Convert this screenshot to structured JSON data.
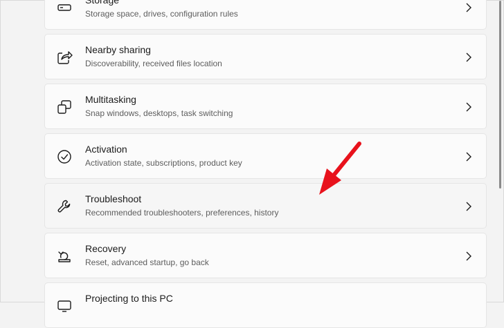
{
  "items": [
    {
      "title": "Storage",
      "subtitle": "Storage space, drives, configuration rules",
      "icon": "storage-icon"
    },
    {
      "title": "Nearby sharing",
      "subtitle": "Discoverability, received files location",
      "icon": "share-icon"
    },
    {
      "title": "Multitasking",
      "subtitle": "Snap windows, desktops, task switching",
      "icon": "multitasking-icon"
    },
    {
      "title": "Activation",
      "subtitle": "Activation state, subscriptions, product key",
      "icon": "check-circle-icon"
    },
    {
      "title": "Troubleshoot",
      "subtitle": "Recommended troubleshooters, preferences, history",
      "icon": "wrench-icon"
    },
    {
      "title": "Recovery",
      "subtitle": "Reset, advanced startup, go back",
      "icon": "recovery-icon"
    },
    {
      "title": "Projecting to this PC",
      "subtitle": "",
      "icon": "projecting-icon"
    }
  ],
  "colors": {
    "accent_arrow": "#e8121c",
    "card_bg": "#fbfbfb",
    "page_bg": "#f3f3f3"
  }
}
